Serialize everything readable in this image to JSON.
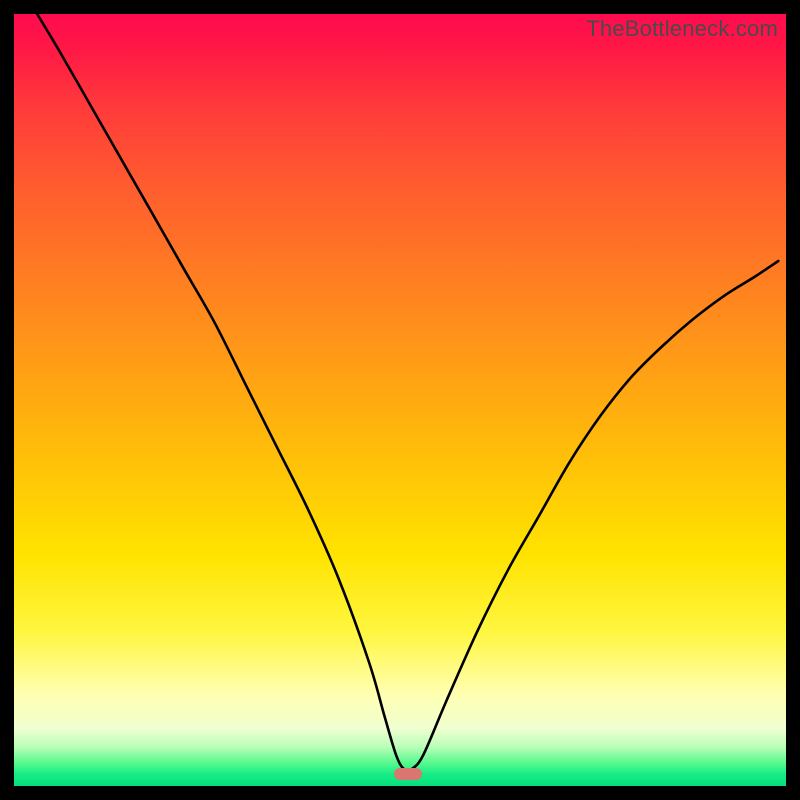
{
  "watermark": "TheBottleneck.com",
  "colors": {
    "curve_stroke": "#000000",
    "marker_fill": "#d8766f",
    "frame_bg": "#000000"
  },
  "chart_data": {
    "type": "line",
    "title": "",
    "xlabel": "",
    "ylabel": "",
    "xlim": [
      0,
      100
    ],
    "ylim": [
      0,
      100
    ],
    "grid": false,
    "series": [
      {
        "name": "bottleneck-curve",
        "x": [
          3,
          6,
          10,
          14,
          18,
          22,
          26,
          30,
          34,
          38,
          42,
          46,
          48,
          49.5,
          50.5,
          51.5,
          53,
          56,
          60,
          64,
          68,
          72,
          76,
          80,
          84,
          88,
          92,
          96,
          99
        ],
        "y": [
          100,
          95,
          88,
          81,
          74,
          67,
          60,
          52,
          44,
          36,
          27,
          16,
          9,
          4,
          2.2,
          2.2,
          4,
          11,
          20,
          28,
          35,
          42,
          48,
          53,
          57,
          60.5,
          63.5,
          66,
          68
        ]
      }
    ],
    "marker": {
      "x": 51,
      "y": 1.6
    },
    "gradient_stops": [
      {
        "pos": 0,
        "color": "#ff0b4f"
      },
      {
        "pos": 12,
        "color": "#ff3a3b"
      },
      {
        "pos": 34,
        "color": "#ff7d22"
      },
      {
        "pos": 58,
        "color": "#ffc108"
      },
      {
        "pos": 80,
        "color": "#fff640"
      },
      {
        "pos": 92,
        "color": "#f0ffd0"
      },
      {
        "pos": 97,
        "color": "#57f98e"
      },
      {
        "pos": 100,
        "color": "#06e07e"
      }
    ]
  }
}
